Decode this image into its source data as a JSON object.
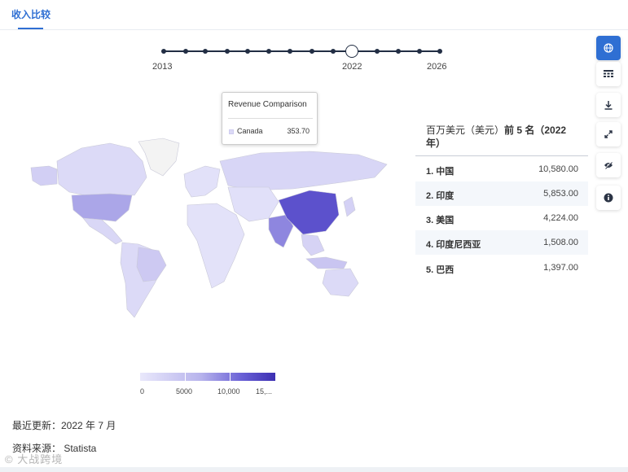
{
  "tab": {
    "label": "收入比较"
  },
  "timeline": {
    "start_label": "2013",
    "selected_label": "2022",
    "end_label": "2026"
  },
  "tooltip": {
    "title": "Revenue Comparison",
    "country": "Canada",
    "value": "353.70"
  },
  "legend": {
    "labels": [
      "0",
      "5000",
      "10,000",
      "15,..."
    ]
  },
  "top5": {
    "title_unit": "百万美元（美元）",
    "title_rank": "前 5 名（2022 年）",
    "rows": [
      {
        "label": "1. 中国",
        "value": "10,580.00"
      },
      {
        "label": "2. 印度",
        "value": "5,853.00"
      },
      {
        "label": "3. 美国",
        "value": "4,224.00"
      },
      {
        "label": "4. 印度尼西亚",
        "value": "1,508.00"
      },
      {
        "label": "5. 巴西",
        "value": "1,397.00"
      }
    ]
  },
  "toolbar": {
    "icons": [
      "globe-icon",
      "table-icon",
      "download-icon",
      "expand-icon",
      "hide-icon",
      "info-icon"
    ],
    "accent": "#2f6fd3"
  },
  "footer": {
    "updated": "最近更新：2022 年 7 月",
    "source": "资料来源： Statista"
  },
  "watermark": {
    "text": "© 大战跨境"
  },
  "colors": {
    "map_low": "#e6e5fb",
    "map_high": "#4a3fc0",
    "no_data": "#f2f2f2"
  }
}
